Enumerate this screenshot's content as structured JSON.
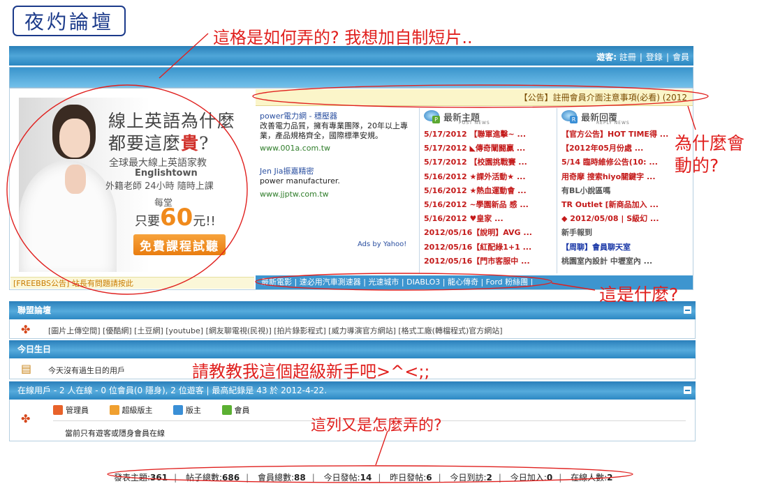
{
  "logo": "夜灼論壇",
  "annotations": {
    "top": "這格是如何弄的? 我想加自制短片..",
    "right_line1": "為什麼會",
    "right_line2": "動的?",
    "what": "這是什麼?",
    "teach": "請教教我這個超級新手吧>^<;;",
    "column": "這列又是怎麼弄的?"
  },
  "header": {
    "guest": "遊客:",
    "register": "註冊",
    "login": "登錄",
    "member": "會員"
  },
  "banner": {
    "title1": "線上英語為什麼",
    "title2a": "都要這麼",
    "title2b": "貴",
    "title2c": "?",
    "line1": "全球最大線上英語家教",
    "brand": "Englishtown",
    "line2": "外籍老師 24小時 隨時上課",
    "each": "每堂",
    "price_pre": "只要",
    "price_num": "60",
    "price_post": "元!!",
    "button": "免費課程試聽"
  },
  "freebbs": "[FREEBBS公告] 站長有問題請按此",
  "notice": "【公告】註冊會員介面注意事項(必看) (2012",
  "ads": [
    {
      "title": "power電力網 - 穩壓器",
      "desc": "改善電力品質，擁有專業團隊，20年以上專業，產品規格齊全，國際標準安規。",
      "url": "www.001a.com.tw"
    },
    {
      "title": "Jen Jia振嘉精密",
      "desc": "power manufacturer.",
      "url": "www.jjptw.com.tw"
    }
  ],
  "ads_by": "Ads by Yahoo!",
  "topics": {
    "title": "最新主題",
    "sub": "POST NEWS",
    "items": [
      "5/17/2012 【聯軍進擊~ ...",
      "5/17/2012 ◣傳奇闡闘贏 ...",
      "5/17/2012 【校園挑戰賽 ...",
      "5/16/2012 ★課外活動★ ...",
      "5/16/2012 ★熱血運動會 ...",
      "5/16/2012 ~學園新品 感 ...",
      "5/16/2012 ♥皇家 ...",
      "2012/05/16【說明】AVG ...",
      "2012/05/16【紅配綠1+1 ...",
      "2012/05/16【門市客服中 ..."
    ]
  },
  "replies": {
    "title": "最新回覆",
    "sub": "REPLY NEWS",
    "items": [
      "【官方公告】HOT TIME得 ...",
      "【2012年05月份處 ...",
      "5/14 臨時維修公告(10: ...",
      "用奇摩 搜索hiyo關鍵字 ...",
      "有BL小說區嗎",
      "TR Outlet [新商品加入 ...",
      "◆ 2012/05/08 | S級幻 ...",
      "新手報到",
      "【周聊】會員聊天室",
      "桃園室內設計 中壢室內 ..."
    ]
  },
  "links_bar": "最新電影 | 速必用汽車測速器 | 光速城市 | DIABLO3 | 龍心傳奇 | Ford 粉絲團 |",
  "alliance": {
    "title": "聯盟論壇",
    "links": "[圖片上傳空間] [優酷網] [土豆網] [youtube] [網友聊電視(民視)] [拍片錄影程式] [威力導演官方網站] [格式工廠(轉檔程式)官方網站]"
  },
  "birthday": {
    "title": "今日生日",
    "text": "今天沒有過生日的用戶"
  },
  "online": {
    "title": "在線用戶 - 2 人在線 - 0 位會員(0 隱身), 2 位遊客 | 最高紀錄是 43 於 2012-4-22.",
    "legend": [
      "管理員",
      "超級版主",
      "版主",
      "會員"
    ],
    "legend_colors": [
      "#e8622a",
      "#f0a030",
      "#3a8fd6",
      "#5bb032"
    ],
    "note": "當前只有遊客或隱身會員在線"
  },
  "stats": {
    "topics_label": "發表主題:",
    "topics": "361",
    "posts_label": "帖子總數:",
    "posts": "686",
    "members_label": "會員總數:",
    "members": "88",
    "today_label": "今日發帖:",
    "today": "14",
    "yesterday_label": "昨日發帖:",
    "yesterday": "6",
    "visits_label": "今日到訪:",
    "visits": "2",
    "joined_label": "今日加入:",
    "joined": "0",
    "online_label": "在線人數:",
    "online": "2"
  }
}
